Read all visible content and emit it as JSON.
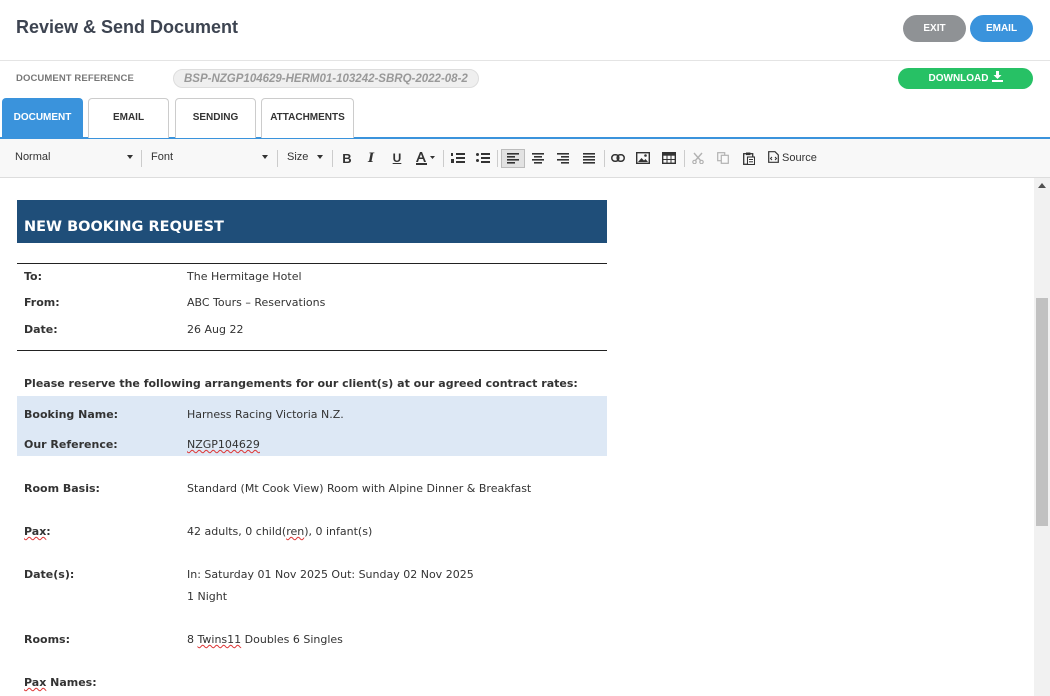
{
  "header": {
    "title": "Review & Send Document",
    "exit_label": "EXIT",
    "email_label": "EMAIL"
  },
  "reference": {
    "label": "DOCUMENT REFERENCE",
    "value": "BSP-NZGP104629-HERM01-103242-SBRQ-2022-08-2",
    "download_label": "DOWNLOAD"
  },
  "tabs": [
    {
      "label": "DOCUMENT",
      "active": true
    },
    {
      "label": "EMAIL",
      "active": false
    },
    {
      "label": "SENDING",
      "active": false
    },
    {
      "label": "ATTACHMENTS",
      "active": false
    }
  ],
  "toolbar": {
    "format_value": "Normal",
    "font_value": "Font",
    "size_value": "Size",
    "source_label": "Source"
  },
  "document": {
    "banner": "NEW BOOKING REQUEST",
    "to_label": "To:",
    "to_value": "The Hermitage Hotel",
    "from_label": "From:",
    "from_value": "ABC Tours – Reservations",
    "date_label": "Date:",
    "date_value": "26 Aug 22",
    "intro": "Please reserve the following arrangements for our client(s) at our agreed contract rates:",
    "booking_name_label": "Booking Name:",
    "booking_name_value": "Harness Racing Victoria N.Z.",
    "our_ref_label": "Our Reference:",
    "our_ref_value": "NZGP104629",
    "room_basis_label": "Room Basis:",
    "room_basis_value": "Standard (Mt Cook View) Room with Alpine Dinner & Breakfast",
    "pax_label": "Pax",
    "pax_colon": ":",
    "pax_value_a": "42 adults, 0 child(",
    "pax_value_b": "ren",
    "pax_value_c": "), 0 infant(s)",
    "dates_label": "Date(s):",
    "dates_value": "In: Saturday 01 Nov 2025 Out: Sunday 02 Nov 2025",
    "nights_value": "1 Night",
    "rooms_label": "Rooms:",
    "rooms_value_a": "8 ",
    "rooms_value_b": "Twins11",
    "rooms_value_c": " Doubles 6 Singles",
    "pax_names_label_a": "Pax",
    "pax_names_label_b": " Names:"
  },
  "colors": {
    "accent": "#3a93dc",
    "exit": "#8f9295",
    "download": "#27c165",
    "banner": "#1f4e79",
    "shade": "#dde8f5"
  }
}
